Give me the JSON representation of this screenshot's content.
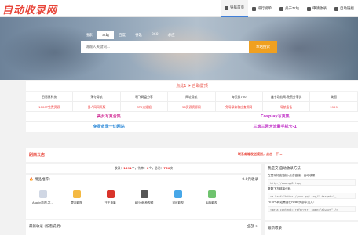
{
  "header": {
    "logo": "自动收录网",
    "nav": [
      {
        "label": "导航首页",
        "icon": "home-icon",
        "active": true
      },
      {
        "label": "排行榜单",
        "icon": "list-icon",
        "active": false
      },
      {
        "label": "关于本站",
        "icon": "user-icon",
        "active": false
      },
      {
        "label": "申请收录",
        "icon": "send-icon",
        "active": false
      },
      {
        "label": "自助链接",
        "icon": "link-icon",
        "active": false
      }
    ]
  },
  "search": {
    "tabs": [
      "搜索",
      "本站",
      "百度",
      "谷歌",
      "360",
      "必应"
    ],
    "active_tab": "本站",
    "placeholder": "请输入关键词...",
    "button": "本站搜索"
  },
  "notice": "点此1 ✈ 自助置顶",
  "grid": [
    [
      "日恩意科技",
      "薄冬导航",
      "啊飞网盘分享",
      "网址导航",
      "每天换700",
      "鑫宇导航网-免费分享优",
      "美国"
    ],
    [
      "1000T免费资源",
      "男人网网页版",
      "BT9大姐姐",
      "56资源资源网",
      "免导录收稿应查源网",
      "导航备备",
      "9999"
    ]
  ],
  "grid_red": [
    [
      false,
      false,
      false,
      false,
      false,
      false,
      false
    ],
    [
      true,
      true,
      true,
      true,
      true,
      true,
      true
    ]
  ],
  "highlights": [
    {
      "left": "美女写真合集",
      "right": "Cosplay写真集"
    },
    {
      "left": "免费收录一切网站",
      "right": "三端三网大流量手机卡-1"
    }
  ],
  "ad": {
    "title": "刷西云店",
    "text": "联系邮箱发送规则，点击一下..."
  },
  "stats": {
    "label1": "收录：",
    "value1": "1391",
    "label2": "个，待审：",
    "value2": "0",
    "label3": "个，总访：",
    "value3": "750",
    "unit": "次"
  },
  "recommend": {
    "title": "精品推荐：",
    "more": "0.0元收录",
    "items": [
      {
        "label": "Auolin影视-发...",
        "icon": "app-icon",
        "color": "#d0d7e4"
      },
      {
        "label": "蒙羽影院",
        "icon": "pinwheel-icon",
        "color": "#f4b942"
      },
      {
        "label": "王王电影",
        "icon": "king-icon",
        "color": "#d9342b"
      },
      {
        "label": "BT99枪枪视频",
        "icon": "film-icon",
        "color": "#555555"
      },
      {
        "label": "可可影视",
        "icon": "pinwheel-icon",
        "color": "#47a7e8"
      },
      {
        "label": "似咖影视",
        "icon": "pinwheel-icon",
        "color": "#6fc36e"
      }
    ]
  },
  "latest": {
    "title": "最新收录 (按看说明)",
    "more": "全部 >"
  },
  "side": {
    "title": "我是交·自动收录方法",
    "lines": [
      "在贯彻好友链接-点击链接，自动收录",
      "http://www.qq8.top/",
      "复制下方链接代码",
      "<a href=\"https://www.qq8.top/\" target=\"_",
      "HTTPS网站需要在head头部中加入：",
      "<meta content=\"referrer\" name=\"always\" />"
    ]
  },
  "side2": {
    "title": "最新收录"
  }
}
